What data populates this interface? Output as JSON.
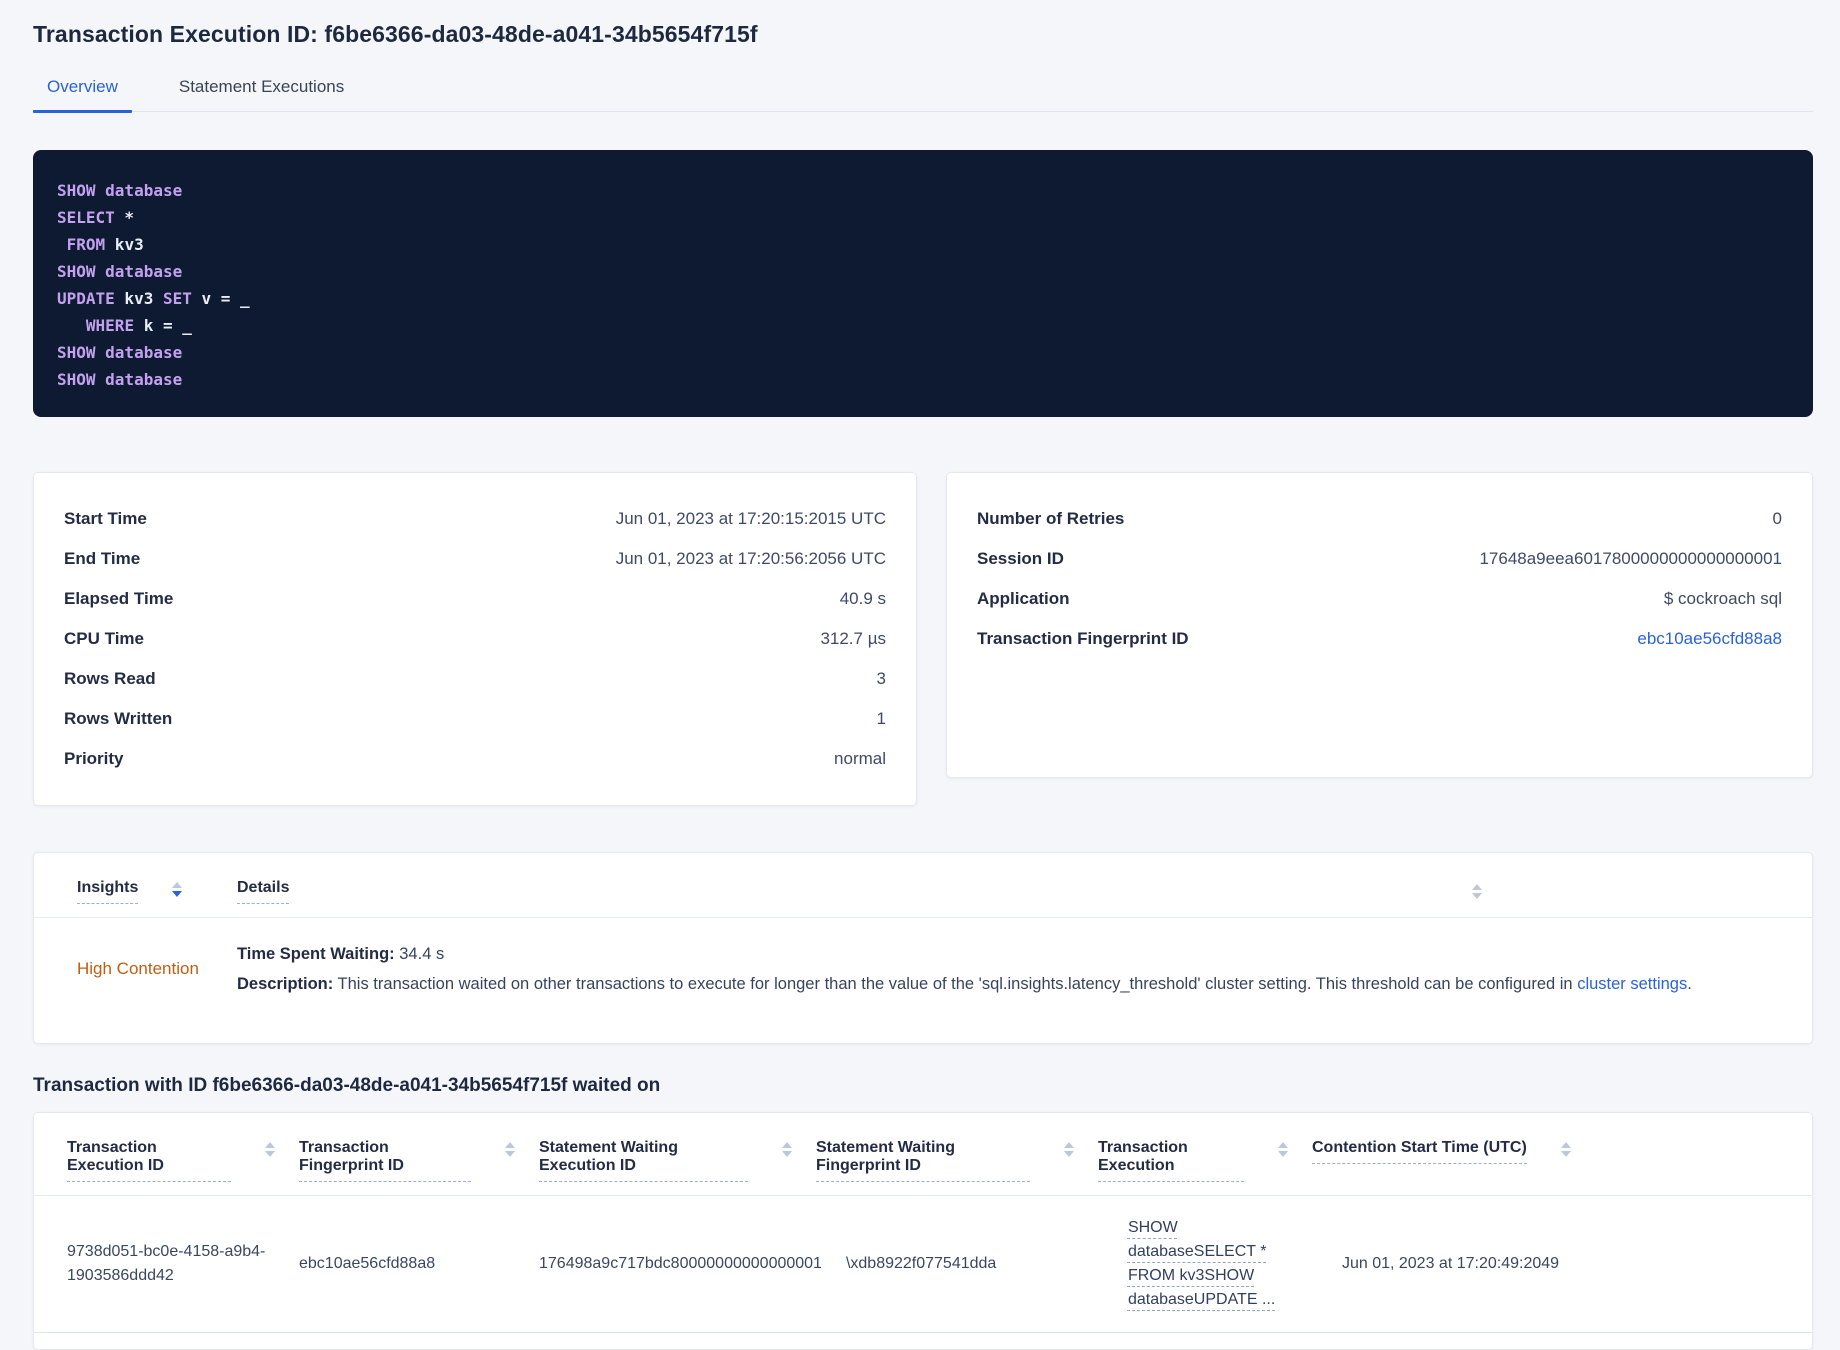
{
  "header": {
    "title": "Transaction Execution ID: f6be6366-da03-48de-a041-34b5654f715f"
  },
  "tabs": {
    "overview": "Overview",
    "statement_executions": "Statement Executions"
  },
  "sql": {
    "lines": [
      [
        {
          "text": "SHOW database",
          "kw": true
        }
      ],
      [
        {
          "text": "SELECT",
          "kw": true
        },
        {
          "text": " *",
          "kw": false
        }
      ],
      [
        {
          "text": " ",
          "kw": false
        },
        {
          "text": "FROM",
          "kw": true
        },
        {
          "text": " kv3",
          "kw": false
        }
      ],
      [
        {
          "text": "SHOW database",
          "kw": true
        }
      ],
      [
        {
          "text": "UPDATE",
          "kw": true
        },
        {
          "text": " kv3 ",
          "kw": false
        },
        {
          "text": "SET",
          "kw": true
        },
        {
          "text": " v = _",
          "kw": false
        }
      ],
      [
        {
          "text": "   ",
          "kw": false
        },
        {
          "text": "WHERE",
          "kw": true
        },
        {
          "text": " k = _",
          "kw": false
        }
      ],
      [
        {
          "text": "SHOW database",
          "kw": true
        }
      ],
      [
        {
          "text": "SHOW database",
          "kw": true
        }
      ]
    ]
  },
  "summary_card": {
    "rows": [
      {
        "key": "start-time",
        "label": "Start Time",
        "value": "Jun 01, 2023 at 17:20:15:2015 UTC"
      },
      {
        "key": "end-time",
        "label": "End Time",
        "value": "Jun 01, 2023 at 17:20:56:2056 UTC"
      },
      {
        "key": "elapsed-time",
        "label": "Elapsed Time",
        "value": "40.9 s"
      },
      {
        "key": "cpu-time",
        "label": "CPU Time",
        "value": "312.7 µs"
      },
      {
        "key": "rows-read",
        "label": "Rows Read",
        "value": "3"
      },
      {
        "key": "rows-written",
        "label": "Rows Written",
        "value": "1"
      },
      {
        "key": "priority",
        "label": "Priority",
        "value": "normal"
      }
    ]
  },
  "meta_card": {
    "rows": [
      {
        "key": "number-of-retries",
        "label": "Number of Retries",
        "value": "0"
      },
      {
        "key": "session-id",
        "label": "Session ID",
        "value": "17648a9eea6017800000000000000001"
      },
      {
        "key": "application",
        "label": "Application",
        "value": "$ cockroach sql"
      },
      {
        "key": "transaction-fingerprint-id",
        "label": "Transaction Fingerprint ID",
        "value": "ebc10ae56cfd88a8",
        "link": true
      }
    ]
  },
  "insights": {
    "columns": {
      "insights": "Insights",
      "details": "Details"
    },
    "row": {
      "insight": "High Contention",
      "waiting_label": "Time Spent Waiting:",
      "waiting_value": " 34.4 s",
      "description_label": "Description:",
      "description_text": " This transaction waited on other transactions to execute for longer than the value of the 'sql.insights.latency_threshold' cluster setting. This threshold can be configured in ",
      "description_link": "cluster settings",
      "description_suffix": "."
    }
  },
  "waited_on": {
    "heading": "Transaction with ID f6be6366-da03-48de-a041-34b5654f715f waited on",
    "columns": [
      {
        "key": "transaction-execution-id",
        "label": "Transaction Execution ID"
      },
      {
        "key": "transaction-fingerprint-id",
        "label": "Transaction Fingerprint ID"
      },
      {
        "key": "statement-waiting-execution-id",
        "label": "Statement Waiting Execution ID"
      },
      {
        "key": "statement-waiting-fingerprint-id",
        "label": "Statement Waiting Fingerprint ID"
      },
      {
        "key": "transaction-execution",
        "label": "Transaction Execution"
      },
      {
        "key": "contention-start-time",
        "label": "Contention Start Time (UTC)"
      }
    ],
    "row": {
      "transaction-execution-id": "9738d051-bc0e-4158-a9b4-1903586ddd42",
      "transaction-fingerprint-id": "ebc10ae56cfd88a8",
      "statement-waiting-execution-id": "176498a9c717bdc80000000000000001",
      "statement-waiting-fingerprint-id": "\\xdb8922f077541dda",
      "transaction-execution": "SHOW databaseSELECT * FROM kv3SHOW databaseUPDATE ...",
      "contention-start-time": "Jun 01, 2023 at 17:20:49:2049"
    }
  },
  "colors": {
    "accent_blue": "#2962d9",
    "insight_warning_orange": "#c15e13",
    "sql_keyword_purple": "#c3a1ef",
    "sql_box_background": "#0d1a31",
    "page_background": "#f4f6fa"
  }
}
